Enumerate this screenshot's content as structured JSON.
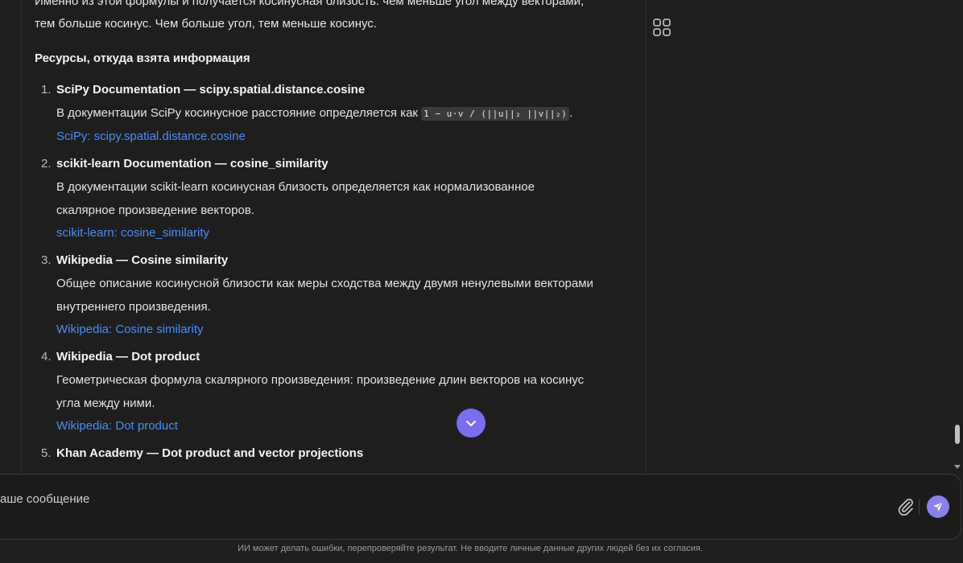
{
  "content": {
    "intro_line1": "Именно из этой формулы и получается косинусная близость: чем меньше угол между векторами,",
    "intro_line2": "тем больше косинус. Чем больше угол, тем меньше косинус.",
    "sources_heading": "Ресурсы, откуда взята информация",
    "sources": [
      {
        "number": "1.",
        "title": "SciPy Documentation — scipy.spatial.distance.cosine",
        "desc_before": "В документации SciPy косинусное расстояние определяется как ",
        "code": "1 − u·v / (||u||₂ ||v||₂)",
        "desc_after": ".",
        "link": "SciPy: scipy.spatial.distance.cosine"
      },
      {
        "number": "2.",
        "title": "scikit-learn Documentation — cosine_similarity",
        "desc_line1": "В документации scikit-learn косинусная близость определяется как нормализованное",
        "desc_line2": "скалярное произведение векторов.",
        "link": "scikit-learn: cosine_similarity"
      },
      {
        "number": "3.",
        "title": "Wikipedia — Cosine similarity",
        "desc_line1": "Общее описание косинусной близости как меры сходства между двумя ненулевыми векторами",
        "desc_line2": "внутреннего произведения.",
        "link": "Wikipedia: Cosine similarity"
      },
      {
        "number": "4.",
        "title": "Wikipedia — Dot product",
        "desc_line1": "Геометрическая формула скалярного произведения: произведение длин векторов на косинус",
        "desc_line2": "угла между ними.",
        "link": "Wikipedia: Dot product"
      },
      {
        "number": "5.",
        "title": "Khan Academy — Dot product and vector projections"
      }
    ]
  },
  "composer": {
    "placeholder": "аше сообщение"
  },
  "footer": {
    "disclaimer": "ИИ может делать ошибки, перепроверяйте результат. Не вводите личные данные других людей без их согласия."
  },
  "colors": {
    "link": "#4c8df6",
    "accent": "#7b6cf0",
    "background": "#1e1e1e"
  },
  "icons": {
    "panel": "grid-icon",
    "scroll_down": "chevron-down-icon",
    "attach": "paperclip-icon",
    "send": "send-icon"
  }
}
